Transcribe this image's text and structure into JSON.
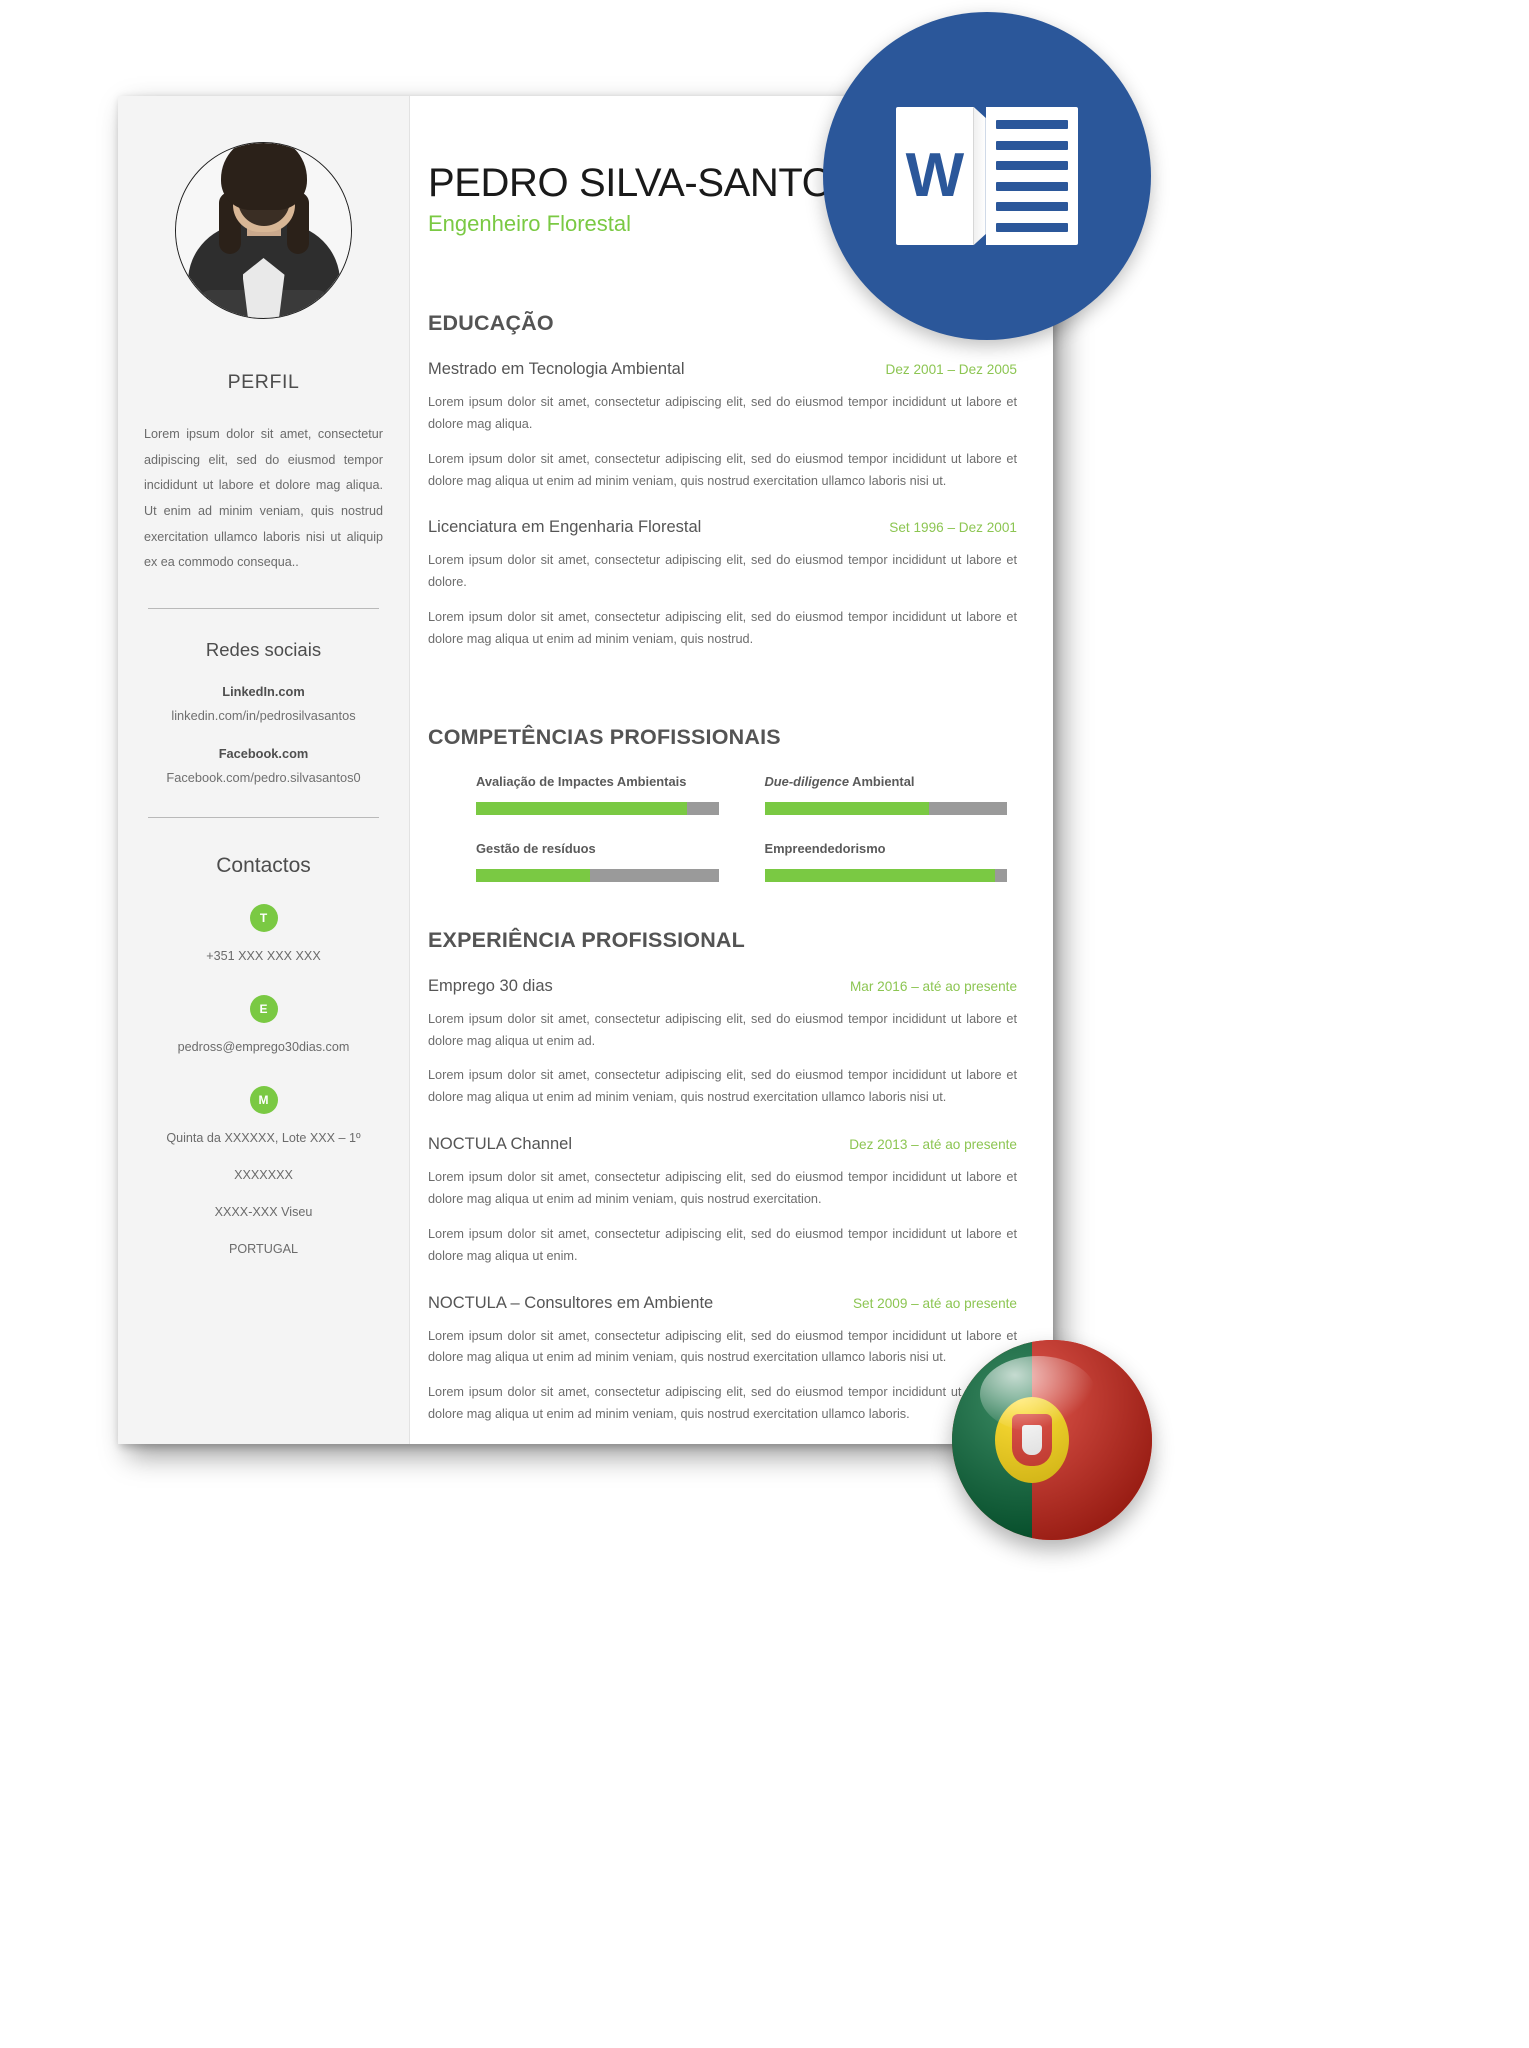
{
  "document": {
    "file_type_badge": "word-document",
    "word_logo_letter": "W",
    "flag_badge": "portugal-flag"
  },
  "header": {
    "name": "PEDRO SILVA-SANTOS",
    "role": "Engenheiro Florestal"
  },
  "sidebar": {
    "profile_heading": "PERFIL",
    "profile_text": "Lorem ipsum dolor sit amet, consectetur adipiscing elit, sed do eiusmod tempor incididunt ut labore et dolore mag aliqua. Ut enim ad minim veniam, quis nostrud exercitation ullamco laboris nisi ut aliquip ex ea commodo consequa..",
    "social_heading": "Redes sociais",
    "social": [
      {
        "name": "LinkedIn.com",
        "url": "linkedin.com/in/pedrosilvasantos"
      },
      {
        "name": "Facebook.com",
        "url": "Facebook.com/pedro.silvasantos0"
      }
    ],
    "contacts_heading": "Contactos",
    "contacts": [
      {
        "icon": "T",
        "icon_name": "telephone-icon",
        "value": "+351 XXX XXX XXX"
      },
      {
        "icon": "E",
        "icon_name": "email-icon",
        "value": "pedross@emprego30dias.com"
      },
      {
        "icon": "M",
        "icon_name": "morada-icon",
        "value": "Quinta da XXXXXX, Lote XXX – 1º"
      }
    ],
    "address_lines": [
      "Quinta da XXXXXX, Lote XXX – 1º",
      "XXXXXXX",
      "XXXX-XXX Viseu",
      "PORTUGAL"
    ]
  },
  "education": {
    "heading": "EDUCAÇÃO",
    "entries": [
      {
        "title": "Mestrado em Tecnologia Ambiental",
        "date": "Dez 2001 – Dez 2005",
        "paragraphs": [
          "Lorem ipsum dolor sit amet, consectetur adipiscing elit, sed do eiusmod tempor incididunt ut labore et dolore mag aliqua.",
          "Lorem ipsum dolor sit amet, consectetur adipiscing elit, sed do eiusmod tempor incididunt ut labore et dolore mag aliqua ut enim ad minim veniam, quis nostrud exercitation ullamco laboris nisi ut."
        ]
      },
      {
        "title": "Licenciatura em Engenharia Florestal",
        "date": "Set 1996 – Dez 2001",
        "paragraphs": [
          "Lorem ipsum dolor sit amet, consectetur adipiscing elit, sed do eiusmod tempor incididunt ut labore et dolore.",
          "Lorem ipsum dolor sit amet, consectetur adipiscing elit, sed do eiusmod tempor incididunt ut labore et dolore mag aliqua ut enim ad minim veniam, quis nostrud."
        ]
      }
    ]
  },
  "skills": {
    "heading": "COMPETÊNCIAS PROFISSIONAIS",
    "items": [
      {
        "label": "Avaliação de Impactes Ambientais",
        "label_italic": "",
        "label_rest": "",
        "percent": 87
      },
      {
        "label": "",
        "label_italic": "Due-diligence",
        "label_rest": " Ambiental",
        "percent": 68
      },
      {
        "label": "Gestão de resíduos",
        "label_italic": "",
        "label_rest": "",
        "percent": 47
      },
      {
        "label": "Empreendedorismo",
        "label_italic": "",
        "label_rest": "",
        "percent": 95
      }
    ]
  },
  "experience": {
    "heading": "EXPERIÊNCIA PROFISSIONAL",
    "entries": [
      {
        "title": "Emprego 30 dias",
        "date": "Mar 2016 – até ao presente",
        "paragraphs": [
          "Lorem ipsum dolor sit amet, consectetur adipiscing elit, sed do eiusmod tempor incididunt ut labore et dolore mag aliqua ut enim ad.",
          "Lorem ipsum dolor sit amet, consectetur adipiscing elit, sed do eiusmod tempor incididunt ut labore et dolore mag aliqua ut enim ad minim veniam, quis nostrud exercitation ullamco laboris nisi ut."
        ]
      },
      {
        "title": "NOCTULA Channel",
        "date": "Dez 2013 – até ao presente",
        "paragraphs": [
          "Lorem ipsum dolor sit amet, consectetur adipiscing elit, sed do eiusmod tempor incididunt ut labore et dolore mag aliqua ut enim ad minim veniam, quis nostrud exercitation.",
          "Lorem ipsum dolor sit amet, consectetur adipiscing elit, sed do eiusmod tempor incididunt ut labore et dolore mag aliqua ut enim."
        ]
      },
      {
        "title": "NOCTULA – Consultores em Ambiente",
        "date": "Set 2009 – até ao presente",
        "paragraphs": [
          "Lorem ipsum dolor sit amet, consectetur adipiscing elit, sed do eiusmod tempor incididunt ut labore et dolore mag aliqua ut enim ad minim veniam, quis nostrud exercitation ullamco laboris nisi ut.",
          "Lorem ipsum dolor sit amet, consectetur adipiscing elit, sed do eiusmod tempor incididunt ut labore et dolore mag aliqua ut enim ad minim veniam, quis nostrud exercitation ullamco laboris."
        ]
      }
    ]
  },
  "colors": {
    "accent_green": "#7ac943",
    "date_green": "#8cc552",
    "heading_gray": "#545454",
    "sidebar_bg": "#f4f4f4",
    "word_blue": "#2b579a"
  }
}
